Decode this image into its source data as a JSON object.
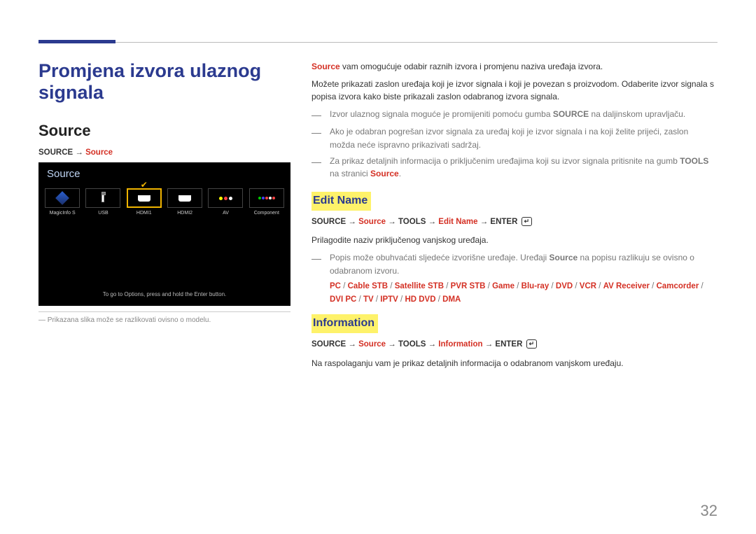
{
  "page_number": "32",
  "h1": "Promjena izvora ulaznog signala",
  "left": {
    "h2": "Source",
    "path_pre": "SOURCE",
    "path_arrow": " → ",
    "path_source": "Source",
    "disclaimer": "Prikazana slika može se razlikovati ovisno o modelu."
  },
  "screenshot": {
    "title": "Source",
    "tiles": [
      {
        "label": "MagicInfo S",
        "icon": "magic"
      },
      {
        "label": "USB",
        "icon": "usb"
      },
      {
        "label": "HDMI1",
        "icon": "hdmi",
        "selected": true
      },
      {
        "label": "HDMI2",
        "icon": "hdmi"
      },
      {
        "label": "AV",
        "icon": "av"
      },
      {
        "label": "Component",
        "icon": "comp"
      }
    ],
    "footer": "To go to Options, press and hold the Enter button."
  },
  "right": {
    "p1_pre": "Source",
    "p1_rest": " vam omogućuje odabir raznih izvora i promjenu naziva uređaja izvora.",
    "p2": "Možete prikazati zaslon uređaja koji je izvor signala i koji je povezan s proizvodom. Odaberite izvor signala s popisa izvora kako biste prikazali zaslon odabranog izvora signala.",
    "note1_pre": "Izvor ulaznog signala moguće je promijeniti pomoću gumba ",
    "note1_bold": "SOURCE",
    "note1_post": " na daljinskom upravljaču.",
    "note2": "Ako je odabran pogrešan izvor signala za uređaj koji je izvor signala i na koji želite prijeći, zaslon možda neće ispravno prikazivati sadržaj.",
    "note3_pre": "Za prikaz detaljnih informacija o priključenim uređajima koji su izvor signala pritisnite na gumb ",
    "note3_bold": "TOOLS",
    "note3_mid": " na stranici ",
    "note3_red": "Source",
    "note3_post": "."
  },
  "edit": {
    "h3": "Edit Name",
    "path_source": "SOURCE",
    "arrow": " → ",
    "src": "Source",
    "tools": "TOOLS",
    "en": "Edit Name",
    "enter": "ENTER",
    "desc": "Prilagodite naziv priključenog vanjskog uređaja.",
    "note_pre": "Popis može obuhvaćati sljedeće izvorišne uređaje. Uređaji ",
    "note_bold": "Source",
    "note_post": " na popisu razlikuju se ovisno o odabranom izvoru.",
    "devices": [
      "PC",
      "Cable STB",
      "Satellite STB",
      "PVR STB",
      "Game",
      "Blu-ray",
      "DVD",
      "VCR",
      "AV Receiver",
      "Camcorder",
      "DVI PC",
      "TV",
      "IPTV",
      "HD DVD",
      "DMA"
    ]
  },
  "info": {
    "h3": "Information",
    "path_source": "SOURCE",
    "arrow": " → ",
    "src": "Source",
    "tools": "TOOLS",
    "inf": "Information",
    "enter": "ENTER",
    "desc": "Na raspolaganju vam je prikaz detaljnih informacija o odabranom vanjskom uređaju."
  }
}
